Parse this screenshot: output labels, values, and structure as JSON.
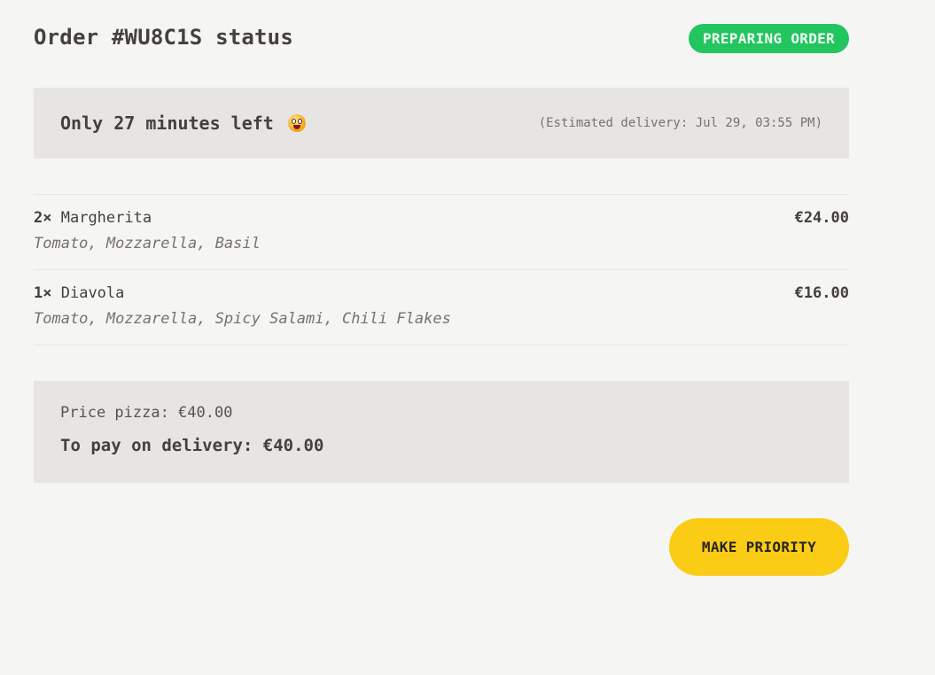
{
  "order": {
    "title": "Order #WU8C1S status",
    "status_badge": "PREPARING ORDER"
  },
  "eta": {
    "message": "Only 27 minutes left",
    "emoji": "grinning-face-emoji",
    "estimated": "(Estimated delivery: Jul 29, 03:55 PM)"
  },
  "items": [
    {
      "qty": "2×",
      "name": "Margherita",
      "price": "€24.00",
      "ingredients": "Tomato, Mozzarella, Basil"
    },
    {
      "qty": "1×",
      "name": "Diavola",
      "price": "€16.00",
      "ingredients": "Tomato, Mozzarella, Spicy Salami, Chili Flakes"
    }
  ],
  "summary": {
    "price_pizza": "Price pizza: €40.00",
    "to_pay": "To pay on delivery: €40.00"
  },
  "actions": {
    "priority_label": "MAKE PRIORITY"
  },
  "colors": {
    "background": "#f5f5f4",
    "panel": "#e7e5e4",
    "status_green": "#22c55e",
    "button_yellow": "#facc15",
    "text": "#44403c"
  }
}
